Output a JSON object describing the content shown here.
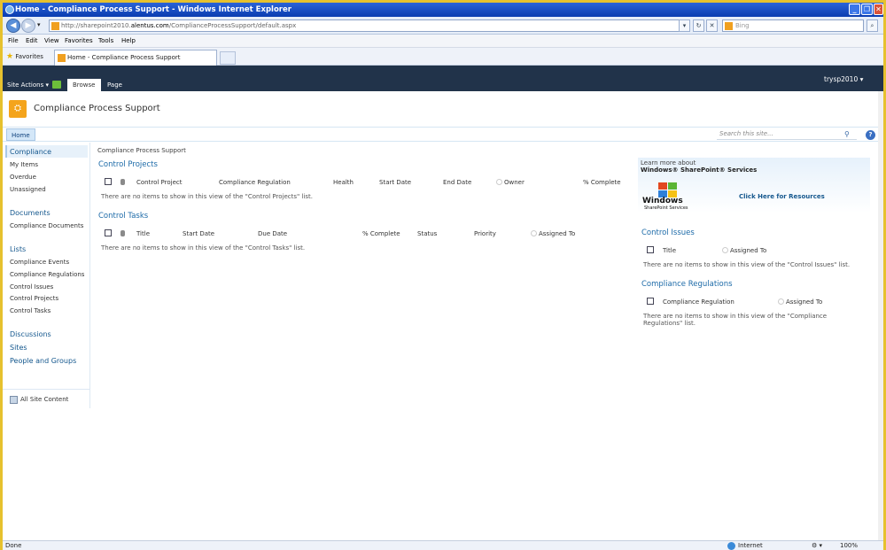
{
  "window": {
    "title": "Home - Compliance Process Support - Windows Internet Explorer",
    "minimize": "_",
    "restore": "❐",
    "close": "✕"
  },
  "address": {
    "url_prefix": "http://sharepoint2010.",
    "url_domain": "alentus.com",
    "url_path": "/ComplianceProcessSupport/default.aspx",
    "search_placeholder": "Bing"
  },
  "menu": [
    "File",
    "Edit",
    "View",
    "Favorites",
    "Tools",
    "Help"
  ],
  "favorites": {
    "label": "Favorites",
    "tab_title": "Home - Compliance Process Support"
  },
  "ribbon": {
    "site_actions": "Site Actions ▾",
    "tabs": [
      "Browse",
      "Page"
    ],
    "user": "trysp2010 ▾"
  },
  "site": {
    "title": "Compliance Process Support",
    "home_tab": "Home",
    "search_placeholder": "Search this site...",
    "help": "?"
  },
  "leftnav": {
    "selected": "Compliance",
    "sub": [
      "My Items",
      "Overdue",
      "Unassigned"
    ],
    "documents_head": "Documents",
    "documents": [
      "Compliance Documents"
    ],
    "lists_head": "Lists",
    "lists": [
      "Compliance Events",
      "Compliance Regulations",
      "Control Issues",
      "Control Projects",
      "Control Tasks"
    ],
    "discussions": "Discussions",
    "sites": "Sites",
    "people": "People and Groups",
    "all_content": "All Site Content"
  },
  "breadcrumb": "Compliance Process Support",
  "control_projects": {
    "title": "Control Projects",
    "columns": [
      "Control Project",
      "Compliance Regulation",
      "Health",
      "Start Date",
      "End Date",
      "Owner",
      "% Complete"
    ],
    "empty": "There are no items to show in this view of the \"Control Projects\" list."
  },
  "control_tasks": {
    "title": "Control Tasks",
    "columns": [
      "Title",
      "Start Date",
      "Due Date",
      "% Complete",
      "Status",
      "Priority",
      "Assigned To"
    ],
    "empty": "There are no items to show in this view of the \"Control Tasks\" list."
  },
  "promo": {
    "learn": "Learn more about",
    "product": "Windows® SharePoint® Services",
    "logo_windows": "Windows",
    "logo_sp": "SharePoint Services",
    "link": "Click Here for Resources"
  },
  "control_issues": {
    "title": "Control Issues",
    "columns": [
      "Title",
      "Assigned To"
    ],
    "empty": "There are no items to show in this view of the \"Control Issues\" list."
  },
  "compliance_regulations": {
    "title": "Compliance Regulations",
    "columns": [
      "Compliance Regulation",
      "Assigned To"
    ],
    "empty_line1": "There are no items to show in this view of the \"Compliance",
    "empty_line2": "Regulations\" list."
  },
  "status": {
    "left": "Done",
    "zone": "Internet",
    "zoom": "100%"
  }
}
